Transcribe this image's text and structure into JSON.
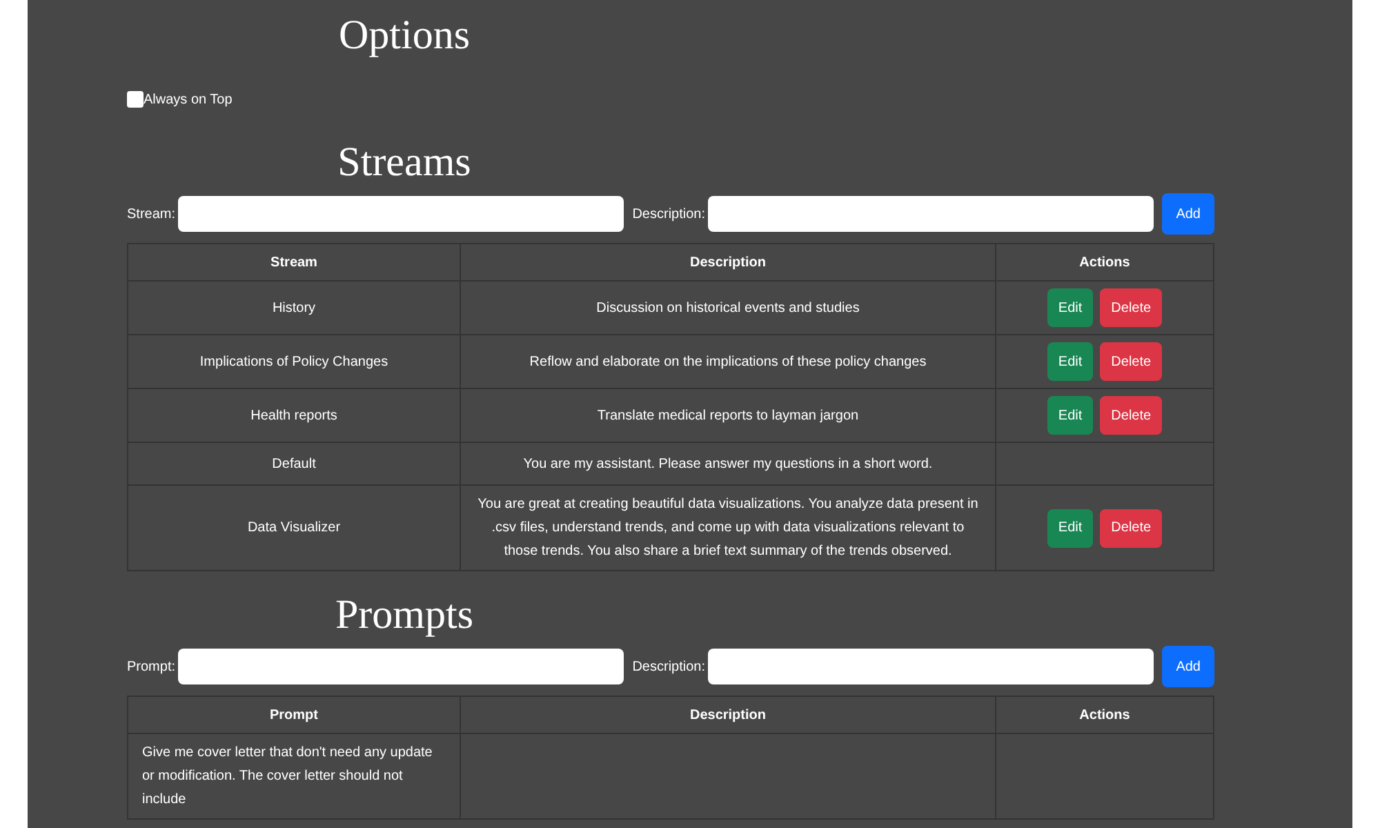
{
  "options": {
    "title": "Options",
    "always_on_top": {
      "label": "Always on Top",
      "checked": false
    }
  },
  "streams": {
    "title": "Streams",
    "form": {
      "name_label": "Stream:",
      "description_label": "Description:",
      "add_button": "Add"
    },
    "columns": [
      "Stream",
      "Description",
      "Actions"
    ],
    "rows": [
      {
        "name": "History",
        "description": "Discussion on historical events and studies",
        "actions": [
          {
            "label": "Edit",
            "kind": "edit"
          },
          {
            "label": "Delete",
            "kind": "delete"
          }
        ]
      },
      {
        "name": "Implications of Policy Changes",
        "description": "Reflow and elaborate on the implications of these policy changes",
        "actions": [
          {
            "label": "Edit",
            "kind": "edit"
          },
          {
            "label": "Delete",
            "kind": "delete"
          }
        ]
      },
      {
        "name": "Health reports",
        "description": "Translate medical reports to layman jargon",
        "actions": [
          {
            "label": "Edit",
            "kind": "edit"
          },
          {
            "label": "Delete",
            "kind": "delete"
          }
        ]
      },
      {
        "name": "Default",
        "description": "You are my assistant. Please answer my questions in a short word.",
        "actions": []
      },
      {
        "name": "Data Visualizer",
        "description": "You are great at creating beautiful data visualizations. You analyze data present in .csv files, understand trends, and come up with data visualizations relevant to those trends. You also share a brief text summary of the trends observed.",
        "actions": [
          {
            "label": "Edit",
            "kind": "edit"
          },
          {
            "label": "Delete",
            "kind": "delete"
          }
        ]
      }
    ]
  },
  "prompts": {
    "title": "Prompts",
    "form": {
      "name_label": "Prompt:",
      "description_label": "Description:",
      "add_button": "Add"
    },
    "columns": [
      "Prompt",
      "Description",
      "Actions"
    ],
    "rows": [
      {
        "name": "Give me cover letter that don't need any update or modification. The cover letter should not include",
        "description": "",
        "actions": []
      }
    ]
  }
}
